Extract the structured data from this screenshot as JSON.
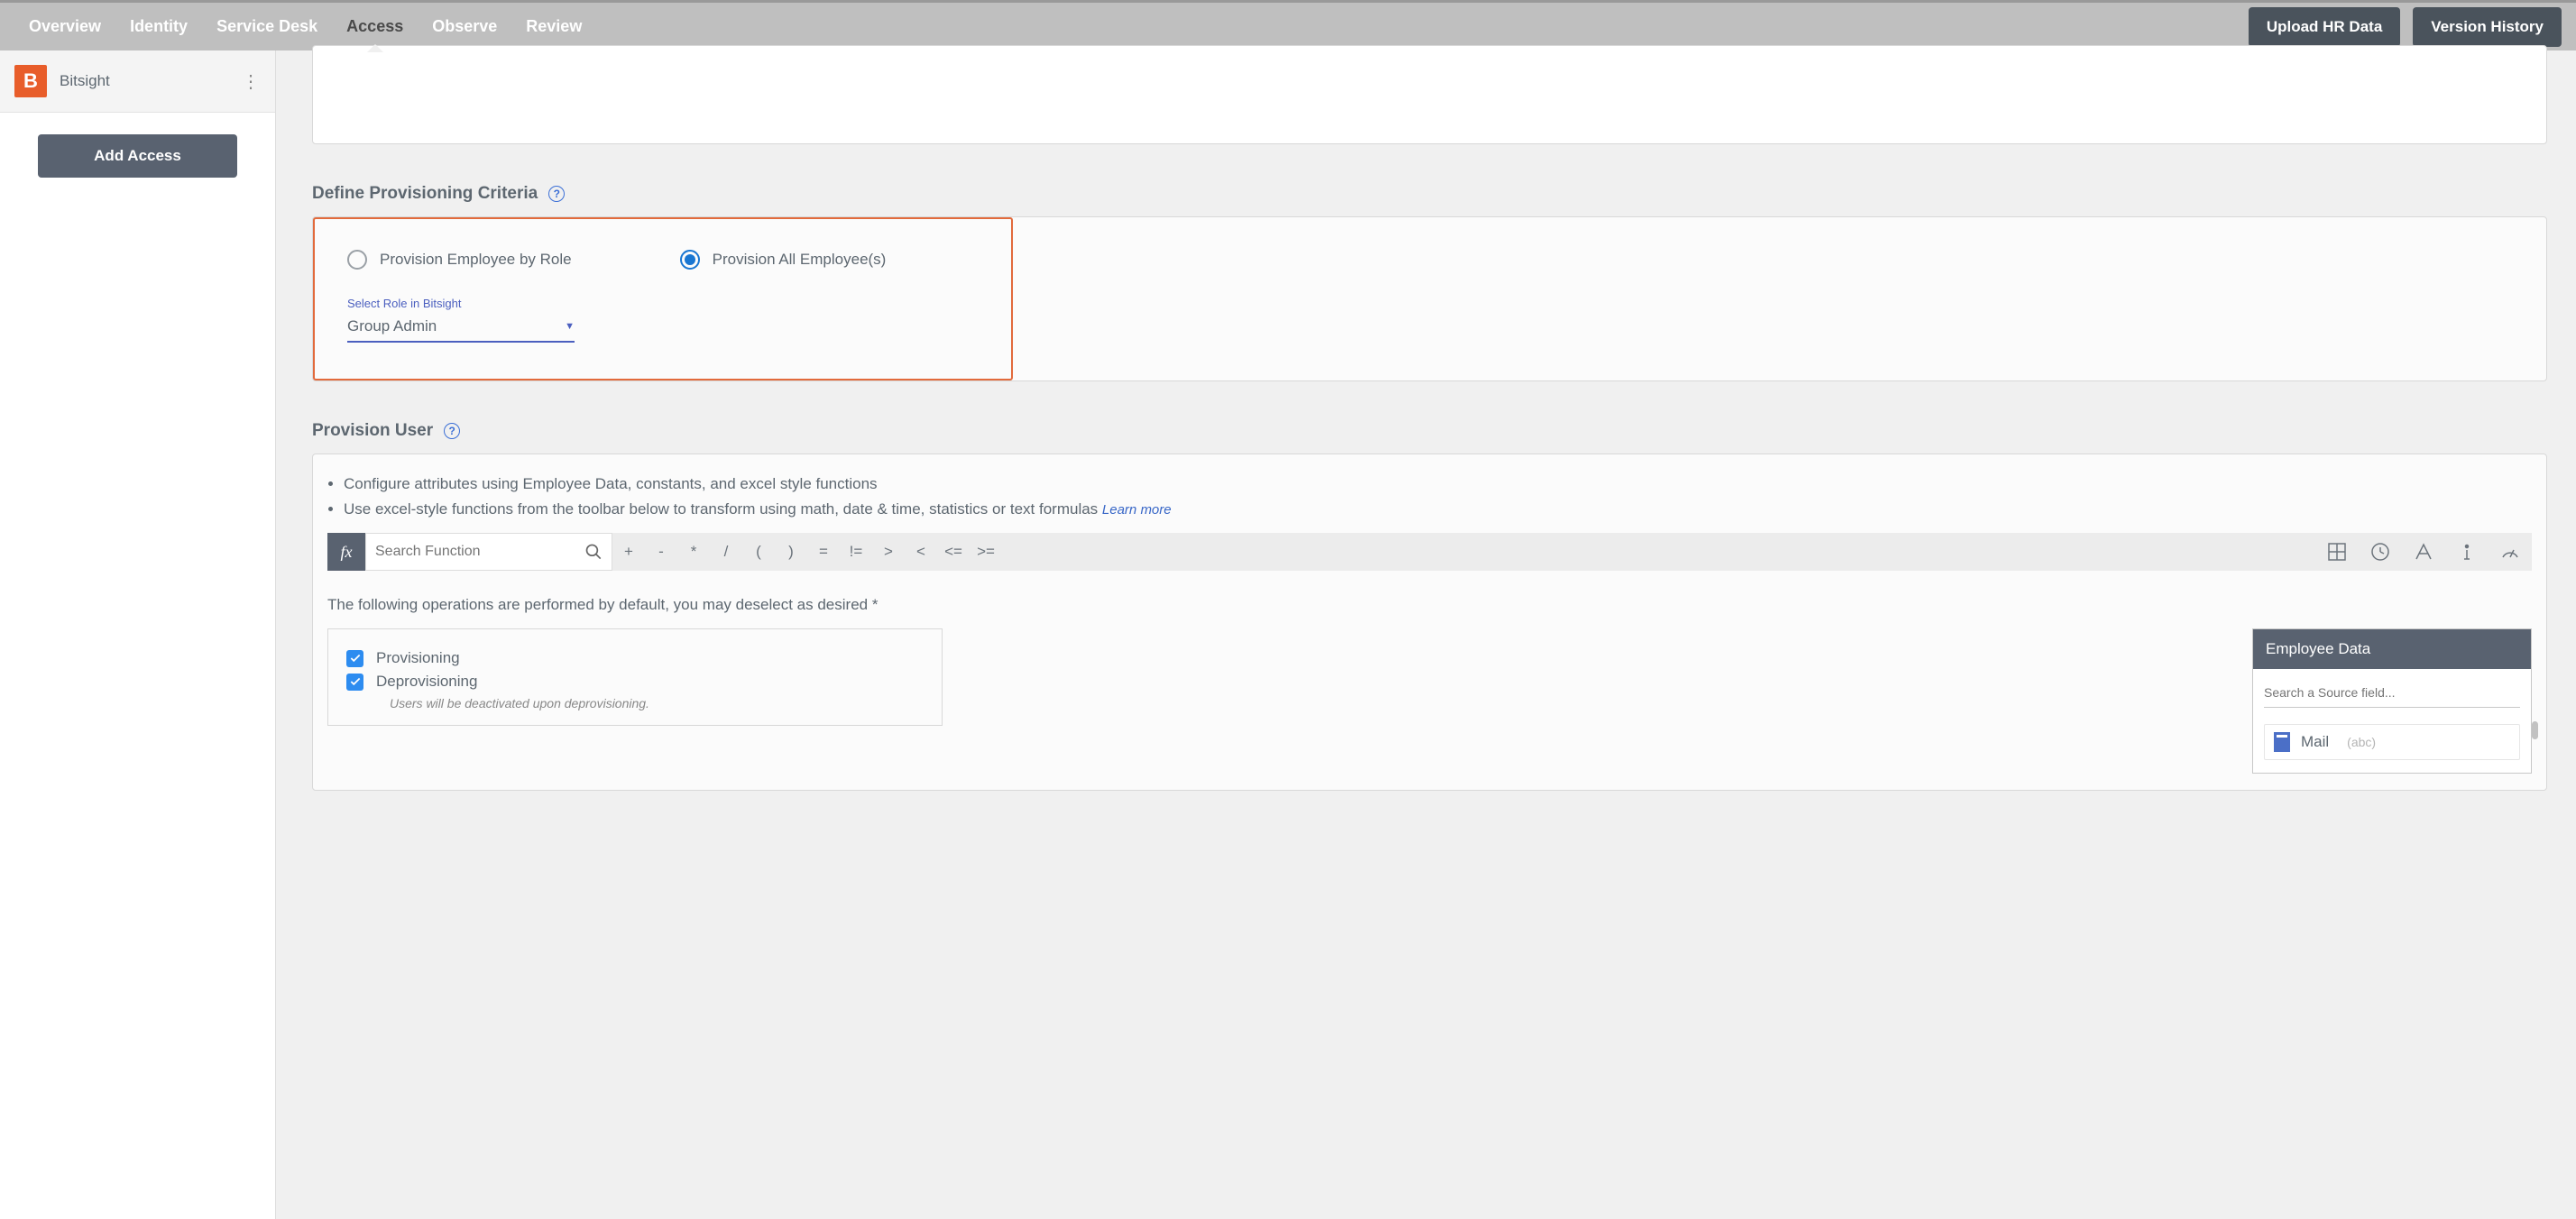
{
  "topbar": {
    "tabs": [
      {
        "label": "Overview",
        "active": false
      },
      {
        "label": "Identity",
        "active": false
      },
      {
        "label": "Service Desk",
        "active": false
      },
      {
        "label": "Access",
        "active": true
      },
      {
        "label": "Observe",
        "active": false
      },
      {
        "label": "Review",
        "active": false
      }
    ],
    "upload_label": "Upload HR Data",
    "version_label": "Version History"
  },
  "sidebar": {
    "app_logo_letter": "B",
    "app_name": "Bitsight",
    "add_access_label": "Add Access"
  },
  "criteria": {
    "title": "Define Provisioning Criteria",
    "radio1_label": "Provision Employee by Role",
    "radio1_selected": false,
    "radio2_label": "Provision All Employee(s)",
    "radio2_selected": true,
    "select_label": "Select Role in Bitsight",
    "select_value": "Group Admin"
  },
  "provision_user": {
    "title": "Provision User",
    "bullet1": "Configure attributes using Employee Data, constants, and excel style functions",
    "bullet2": "Use excel-style functions from the toolbar below to transform using math, date & time, statistics or text formulas",
    "learn_more": "Learn more",
    "fx_label": "fx",
    "search_placeholder": "Search Function",
    "operators": [
      "+",
      "-",
      "*",
      "/",
      "(",
      ")",
      "=",
      "!=",
      ">",
      "<",
      "<=",
      ">="
    ],
    "operations_note": "The following operations are performed by default, you may deselect as desired *",
    "ops": [
      {
        "label": "Provisioning",
        "checked": true
      },
      {
        "label": "Deprovisioning",
        "checked": true
      }
    ],
    "deprov_note": "Users will be deactivated upon deprovisioning."
  },
  "employee_data": {
    "title": "Employee Data",
    "search_placeholder": "Search a Source field...",
    "field_name": "Mail",
    "field_type": "(abc)"
  }
}
